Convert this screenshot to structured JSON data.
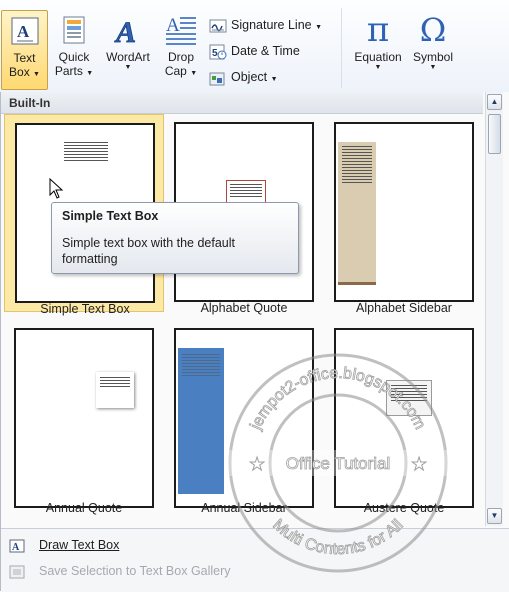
{
  "ribbon": {
    "text_box": {
      "line1": "Text",
      "line2": "Box"
    },
    "quick_parts": {
      "line1": "Quick",
      "line2": "Parts"
    },
    "wordart": {
      "line1": "WordArt"
    },
    "drop_cap": {
      "line1": "Drop",
      "line2": "Cap"
    },
    "signature_line": "Signature Line",
    "date_time": "Date & Time",
    "object": "Object",
    "equation": "Equation",
    "symbol": "Symbol",
    "equation_glyph": "π",
    "symbol_glyph": "Ω"
  },
  "gallery": {
    "section": "Built-In",
    "items": [
      {
        "label": "Simple Text Box",
        "selected": true
      },
      {
        "label": "Alphabet Quote"
      },
      {
        "label": "Alphabet Sidebar"
      },
      {
        "label": "Annual Quote"
      },
      {
        "label": "Annual Sidebar"
      },
      {
        "label": "Austere Quote"
      }
    ]
  },
  "tooltip": {
    "title": "Simple Text Box",
    "body": "Simple text box with the default formatting"
  },
  "commands": {
    "draw": "Draw Text Box",
    "save": "Save Selection to Text Box Gallery"
  },
  "watermark": {
    "top": "jempot2-office.blogspot.com",
    "middle": "Office Tutorial",
    "bottom": "Multi Contents for All"
  },
  "colors": {
    "accent": "#3a6db5",
    "selected": "#fde9a6",
    "sidebar_blue": "#4a7fc1",
    "sidebar_tan": "#d9ccb0"
  },
  "icons": [
    "text-box-icon",
    "quick-parts-icon",
    "wordart-icon",
    "drop-cap-icon",
    "signature-line-icon",
    "date-time-icon",
    "object-icon",
    "draw-text-box-icon",
    "save-selection-icon"
  ]
}
